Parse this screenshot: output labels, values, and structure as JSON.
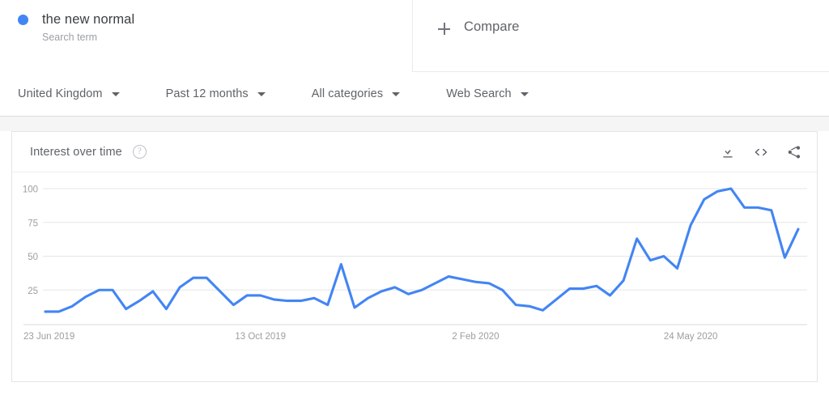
{
  "search_term": {
    "name": "the new normal",
    "type_label": "Search term",
    "dot_color": "#4285f4"
  },
  "compare": {
    "label": "Compare",
    "icon": "plus-icon"
  },
  "filters": [
    {
      "label": "United Kingdom",
      "icon": "chevron-down-icon"
    },
    {
      "label": "Past 12 months",
      "icon": "chevron-down-icon"
    },
    {
      "label": "All categories",
      "icon": "chevron-down-icon"
    },
    {
      "label": "Web Search",
      "icon": "chevron-down-icon"
    }
  ],
  "interest_card": {
    "title": "Interest over time",
    "help_icon": "?",
    "actions": [
      {
        "name": "download-icon",
        "tooltip": "Download"
      },
      {
        "name": "embed-code-icon",
        "tooltip": "Embed"
      },
      {
        "name": "share-icon",
        "tooltip": "Share"
      }
    ]
  },
  "chart_data": {
    "type": "line",
    "title": "Interest over time",
    "xlabel": "",
    "ylabel": "",
    "ylim": [
      0,
      100
    ],
    "yticks": [
      25,
      50,
      75,
      100
    ],
    "grid": true,
    "legend": false,
    "line_color": "#4285f4",
    "xtick_labels": [
      "23 Jun 2019",
      "13 Oct 2019",
      "2 Feb 2020",
      "24 May 2020"
    ],
    "xtick_positions": [
      0,
      16,
      32,
      48
    ],
    "series": [
      {
        "name": "the new normal",
        "values": [
          9,
          9,
          13,
          20,
          25,
          25,
          11,
          17,
          24,
          11,
          27,
          34,
          34,
          24,
          14,
          21,
          21,
          18,
          17,
          17,
          19,
          14,
          44,
          12,
          19,
          24,
          27,
          22,
          25,
          30,
          35,
          33,
          31,
          30,
          25,
          14,
          13,
          10,
          18,
          26,
          26,
          28,
          21,
          32,
          63,
          47,
          50,
          41,
          73,
          92,
          98,
          100,
          86,
          86,
          84,
          49,
          70
        ]
      }
    ]
  }
}
